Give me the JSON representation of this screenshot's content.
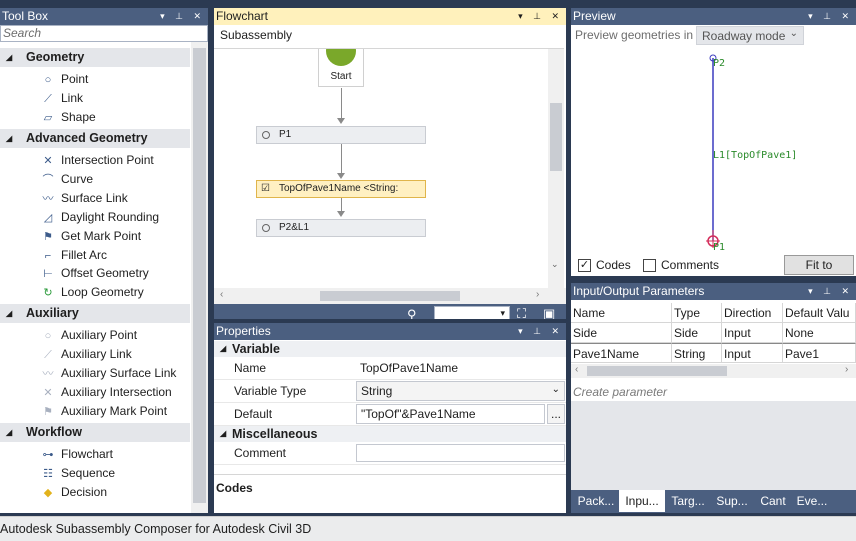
{
  "toolbox": {
    "title": "Tool Box",
    "search_placeholder": "Search",
    "categories": [
      {
        "label": "Geometry",
        "items": [
          {
            "label": "Point",
            "icon": "point-icon"
          },
          {
            "label": "Link",
            "icon": "link-icon"
          },
          {
            "label": "Shape",
            "icon": "shape-icon"
          }
        ]
      },
      {
        "label": "Advanced Geometry",
        "items": [
          {
            "label": "Intersection Point",
            "icon": "intersection-point-icon"
          },
          {
            "label": "Curve",
            "icon": "curve-icon"
          },
          {
            "label": "Surface Link",
            "icon": "surface-link-icon"
          },
          {
            "label": "Daylight Rounding",
            "icon": "daylight-rounding-icon"
          },
          {
            "label": "Get Mark Point",
            "icon": "get-mark-point-icon"
          },
          {
            "label": "Fillet Arc",
            "icon": "fillet-arc-icon"
          },
          {
            "label": "Offset Geometry",
            "icon": "offset-geometry-icon"
          },
          {
            "label": "Loop Geometry",
            "icon": "loop-geometry-icon"
          }
        ]
      },
      {
        "label": "Auxiliary",
        "items": [
          {
            "label": "Auxiliary Point",
            "icon": "auxiliary-point-icon"
          },
          {
            "label": "Auxiliary Link",
            "icon": "auxiliary-link-icon"
          },
          {
            "label": "Auxiliary Surface Link",
            "icon": "auxiliary-surface-link-icon"
          },
          {
            "label": "Auxiliary Intersection",
            "icon": "auxiliary-intersection-icon"
          },
          {
            "label": "Auxiliary Mark Point",
            "icon": "auxiliary-mark-point-icon"
          }
        ]
      },
      {
        "label": "Workflow",
        "items": [
          {
            "label": "Flowchart",
            "icon": "flowchart-icon"
          },
          {
            "label": "Sequence",
            "icon": "sequence-icon"
          },
          {
            "label": "Decision",
            "icon": "decision-icon"
          }
        ]
      }
    ]
  },
  "flowchart": {
    "title": "Flowchart",
    "subtitle": "Subassembly",
    "start_label": "Start",
    "nodes": [
      "P1",
      "TopOfPave1Name <String:",
      "P2&L1"
    ]
  },
  "properties": {
    "title": "Properties",
    "section_variable": "Variable",
    "name_label": "Name",
    "name_value": "TopOfPave1Name",
    "type_label": "Variable Type",
    "type_value": "String",
    "default_label": "Default",
    "default_value": "\"TopOf\"&Pave1Name",
    "ellipsis": "...",
    "section_misc": "Miscellaneous",
    "comment_label": "Comment",
    "codes_label": "Codes"
  },
  "preview": {
    "title": "Preview",
    "geom_label": "Preview geometries in",
    "mode_value": "Roadway mode",
    "label_p2": "P2",
    "label_p1": "P1",
    "label_l1": "L1[TopOfPave1]",
    "codes_label": "Codes",
    "codes_checked": true,
    "comments_label": "Comments",
    "comments_checked": false,
    "fit_button": "Fit to Screen",
    "colors": {
      "link": "#3b3bbf",
      "point": "#d42c5a",
      "label": "#2a8a2a"
    }
  },
  "io": {
    "title": "Input/Output Parameters",
    "headers": [
      "Name",
      "Type",
      "Direction",
      "Default Valu"
    ],
    "rows": [
      [
        "Side",
        "Side",
        "Input",
        "None"
      ],
      [
        "Pave1Name",
        "String",
        "Input",
        "Pave1"
      ]
    ],
    "create_placeholder": "Create parameter",
    "tabs": [
      "Pack...",
      "Inpu...",
      "Targ...",
      "Sup...",
      "Cant",
      "Eve..."
    ]
  },
  "status": {
    "text": "Autodesk Subassembly Composer for Autodesk Civil 3D"
  }
}
